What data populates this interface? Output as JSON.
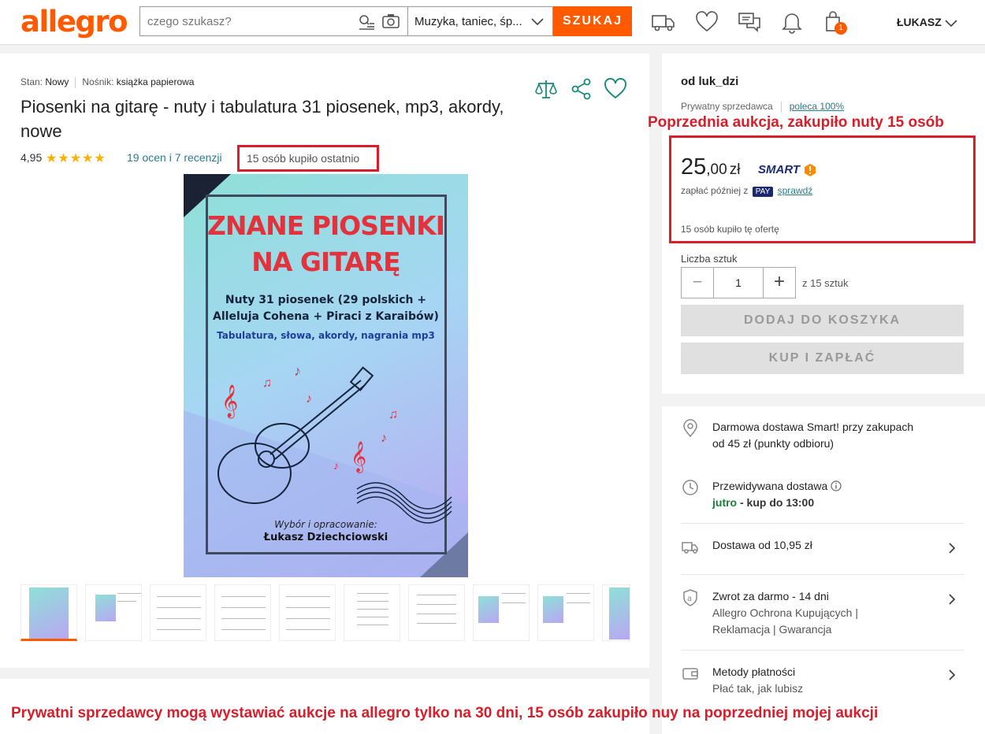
{
  "header": {
    "logo": "allegro",
    "search_placeholder": "czego szukasz?",
    "category": "Muzyka, taniec, śp...",
    "search_button": "SZUKAJ",
    "cart_count": "1",
    "user": "ŁUKASZ"
  },
  "product": {
    "condition_label": "Stan:",
    "condition": "Nowy",
    "medium_label": "Nośnik:",
    "medium": "książka papierowa",
    "title": "Piosenki na gitarę - nuty i tabulatura 31 piosenek, mp3, akordy, nowe",
    "rating": "4,95",
    "stars": "★★★★★",
    "reviews": "19 ocen i 7 recenzji",
    "bought_recently": "15 osób kupiło ostatnio"
  },
  "cover": {
    "title_line1": "ZNANE PIOSENKI",
    "title_line2": "NA GITARĘ",
    "subtitle_line1": "Nuty 31 piosenek (29 polskich +",
    "subtitle_line2": "Alleluja Cohena + Piraci z Karaibów)",
    "tagline": "Tabulatura, słowa, akordy, nagrania mp3",
    "author_label": "Wybór i opracowanie:",
    "author": "Łukasz Dziechciowski"
  },
  "seller": {
    "name": "od luk_dzi",
    "type": "Prywatny sprzedawca",
    "recommend": "poleca 100%"
  },
  "offer": {
    "price_main": "25",
    "price_dec": ",00",
    "currency": "zł",
    "smart": "SMART",
    "pay_later_text": "zapłać później z",
    "pay_tag": "PAY",
    "pay_link": "sprawdź",
    "bought_offer": "15 osób kupiło tę ofertę",
    "qty_label": "Liczba sztuk",
    "qty_value": "1",
    "qty_of": "z 15 sztuk",
    "add_to_cart": "DODAJ DO KOSZYKA",
    "buy_now": "KUP I ZAPŁAĆ"
  },
  "delivery": {
    "free_line1": "Darmowa dostawa Smart! przy zakupach",
    "free_line2": "od 45 zł (punkty odbioru)",
    "expected_label": "Przewidywana dostawa",
    "expected_when": "jutro",
    "expected_rest": " - kup do 13:00",
    "shipping": "Dostawa od 10,95 zł",
    "return_title": "Zwrot za darmo - 14 dni",
    "return_line2": "Allegro Ochrona Kupujących |",
    "return_line3": "Reklamacja | Gwarancja",
    "payment_title": "Metody płatności",
    "payment_sub": "Płać tak, jak lubisz"
  },
  "annotations": {
    "top": "Poprzednia aukcja, zakupiło nuty 15 osób",
    "bottom": "Prywatni sprzedawcy mogą wystawiać aukcje na allegro tylko na 30 dni, 15 osób zakupiło nuy na poprzedniej mojej aukcji"
  },
  "colors": {
    "brand": "#ff5a00",
    "annotation": "#d81e2a",
    "link": "#2b7a8a"
  }
}
